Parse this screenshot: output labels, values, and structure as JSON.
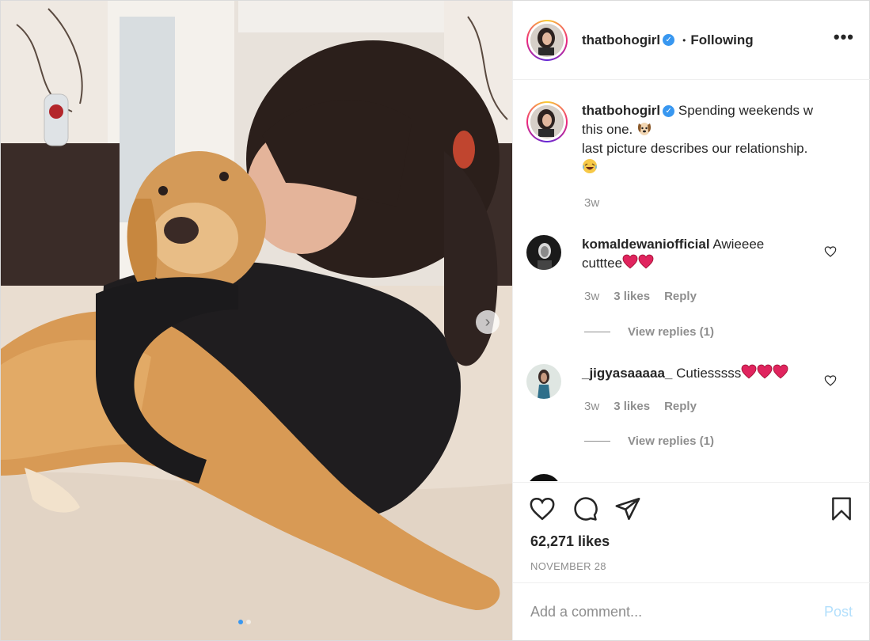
{
  "post": {
    "author": "thatbohogirl",
    "follow_separator": "•",
    "follow_status": "Following",
    "more_label": "•••",
    "caption": {
      "line1": "Spending weekends w",
      "line2": "this one.",
      "line3": "last picture describes our relationship.",
      "time": "3w"
    },
    "comments": [
      {
        "username": "komaldewaniofficial",
        "text_a": "Awieeee",
        "text_b": "cutttee",
        "time": "3w",
        "likes": "3 likes",
        "reply": "Reply",
        "view_replies": "View replies (1)"
      },
      {
        "username": "_jigyasaaaaa_",
        "text_a": "Cutiesssss",
        "time": "3w",
        "likes": "3 likes",
        "reply": "Reply",
        "view_replies": "View replies (1)"
      }
    ],
    "likes": "62,271 likes",
    "date": "NOVEMBER 28",
    "comment_placeholder": "Add a comment...",
    "post_label": "Post",
    "carousel": {
      "total": 2,
      "current": 1
    }
  },
  "colors": {
    "accent": "#3897f0",
    "post_disabled": "#b2dffc",
    "muted": "#8e8e8e",
    "heart_emoji": "#e0245e"
  },
  "icons": [
    "verified-badge-icon",
    "more-options-icon",
    "like-heart-icon",
    "comment-icon",
    "share-icon",
    "save-bookmark-icon",
    "next-arrow-icon",
    "comment-heart-icon"
  ]
}
